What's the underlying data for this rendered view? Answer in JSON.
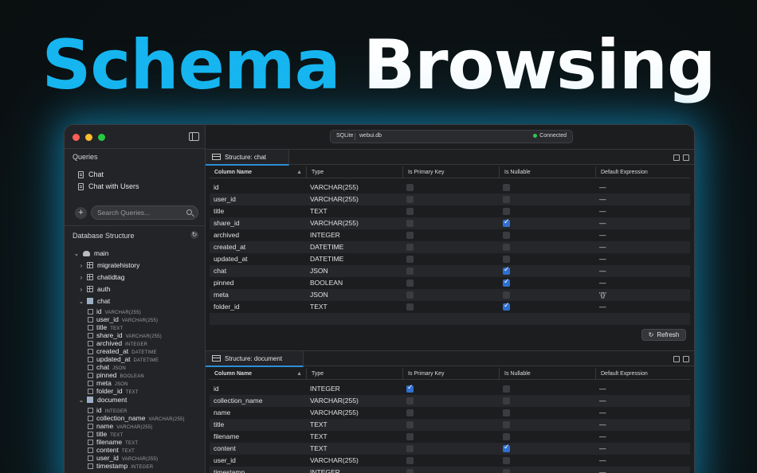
{
  "headline": {
    "word1": "Schema",
    "word2": "Browsing"
  },
  "colors": {
    "accent": "#17b6f0",
    "checked": "#2f6fd1",
    "connected": "#31c550"
  },
  "connection": {
    "engine": "SQLite",
    "database": "webui.db",
    "status": "Connected"
  },
  "sidebar": {
    "queries_title": "Queries",
    "queries": [
      "Chat",
      "Chat with Users"
    ],
    "search_placeholder": "Search Queries...",
    "structure_title": "Database Structure",
    "schema": "main",
    "collapsed_tables": [
      "migratehistory",
      "chatidtag",
      "auth"
    ],
    "chat_table": "chat",
    "chat_columns": [
      {
        "name": "id",
        "type": "VARCHAR(255)"
      },
      {
        "name": "user_id",
        "type": "VARCHAR(255)"
      },
      {
        "name": "title",
        "type": "TEXT"
      },
      {
        "name": "share_id",
        "type": "VARCHAR(255)"
      },
      {
        "name": "archived",
        "type": "INTEGER"
      },
      {
        "name": "created_at",
        "type": "DATETIME"
      },
      {
        "name": "updated_at",
        "type": "DATETIME"
      },
      {
        "name": "chat",
        "type": "JSON"
      },
      {
        "name": "pinned",
        "type": "BOOLEAN"
      },
      {
        "name": "meta",
        "type": "JSON"
      },
      {
        "name": "folder_id",
        "type": "TEXT"
      }
    ],
    "document_table": "document",
    "document_columns": [
      {
        "name": "id",
        "type": "INTEGER"
      },
      {
        "name": "collection_name",
        "type": "VARCHAR(255)"
      },
      {
        "name": "name",
        "type": "VARCHAR(255)"
      },
      {
        "name": "title",
        "type": "TEXT"
      },
      {
        "name": "filename",
        "type": "TEXT"
      },
      {
        "name": "content",
        "type": "TEXT"
      },
      {
        "name": "user_id",
        "type": "VARCHAR(255)"
      },
      {
        "name": "timestamp",
        "type": "INTEGER"
      }
    ]
  },
  "grid_headers": [
    "Column Name",
    "Type",
    "Is Primary Key",
    "Is Nullable",
    "Default Expression"
  ],
  "panel_chat": {
    "tab": "Structure: chat",
    "rows": [
      {
        "name": "id",
        "type": "VARCHAR(255)",
        "pk": false,
        "nullable": false,
        "default": "—"
      },
      {
        "name": "user_id",
        "type": "VARCHAR(255)",
        "pk": false,
        "nullable": false,
        "default": "—"
      },
      {
        "name": "title",
        "type": "TEXT",
        "pk": false,
        "nullable": false,
        "default": "—"
      },
      {
        "name": "share_id",
        "type": "VARCHAR(255)",
        "pk": false,
        "nullable": true,
        "default": "—"
      },
      {
        "name": "archived",
        "type": "INTEGER",
        "pk": false,
        "nullable": false,
        "default": "—"
      },
      {
        "name": "created_at",
        "type": "DATETIME",
        "pk": false,
        "nullable": false,
        "default": "—"
      },
      {
        "name": "updated_at",
        "type": "DATETIME",
        "pk": false,
        "nullable": false,
        "default": "—"
      },
      {
        "name": "chat",
        "type": "JSON",
        "pk": false,
        "nullable": true,
        "default": "—"
      },
      {
        "name": "pinned",
        "type": "BOOLEAN",
        "pk": false,
        "nullable": true,
        "default": "—"
      },
      {
        "name": "meta",
        "type": "JSON",
        "pk": false,
        "nullable": false,
        "default": "'{}'"
      },
      {
        "name": "folder_id",
        "type": "TEXT",
        "pk": false,
        "nullable": true,
        "default": "—"
      }
    ],
    "refresh_label": "Refresh"
  },
  "panel_document": {
    "tab": "Structure: document",
    "rows": [
      {
        "name": "id",
        "type": "INTEGER",
        "pk": true,
        "nullable": false,
        "default": "—"
      },
      {
        "name": "collection_name",
        "type": "VARCHAR(255)",
        "pk": false,
        "nullable": false,
        "default": "—"
      },
      {
        "name": "name",
        "type": "VARCHAR(255)",
        "pk": false,
        "nullable": false,
        "default": "—"
      },
      {
        "name": "title",
        "type": "TEXT",
        "pk": false,
        "nullable": false,
        "default": "—"
      },
      {
        "name": "filename",
        "type": "TEXT",
        "pk": false,
        "nullable": false,
        "default": "—"
      },
      {
        "name": "content",
        "type": "TEXT",
        "pk": false,
        "nullable": true,
        "default": "—"
      },
      {
        "name": "user_id",
        "type": "VARCHAR(255)",
        "pk": false,
        "nullable": false,
        "default": "—"
      },
      {
        "name": "timestamp",
        "type": "INTEGER",
        "pk": false,
        "nullable": false,
        "default": "—"
      }
    ]
  }
}
